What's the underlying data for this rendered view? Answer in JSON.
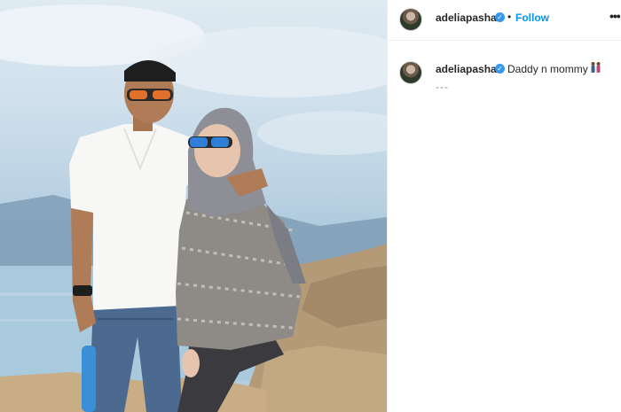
{
  "post": {
    "username": "adeliapasha",
    "verified_glyph": "✓",
    "separator": "•",
    "follow_label": "Follow",
    "more_label": "•••"
  },
  "comment": {
    "username": "adeliapasha",
    "verified_glyph": "✓",
    "caption": "Daddy n mommy",
    "caption_more": "---",
    "emoji": "family-emoji"
  },
  "photo": {
    "subject": "couple-photo"
  },
  "colors": {
    "accent": "#0095f6",
    "verified": "#3897f0",
    "text": "#262626",
    "muted": "#8e8e8e"
  }
}
